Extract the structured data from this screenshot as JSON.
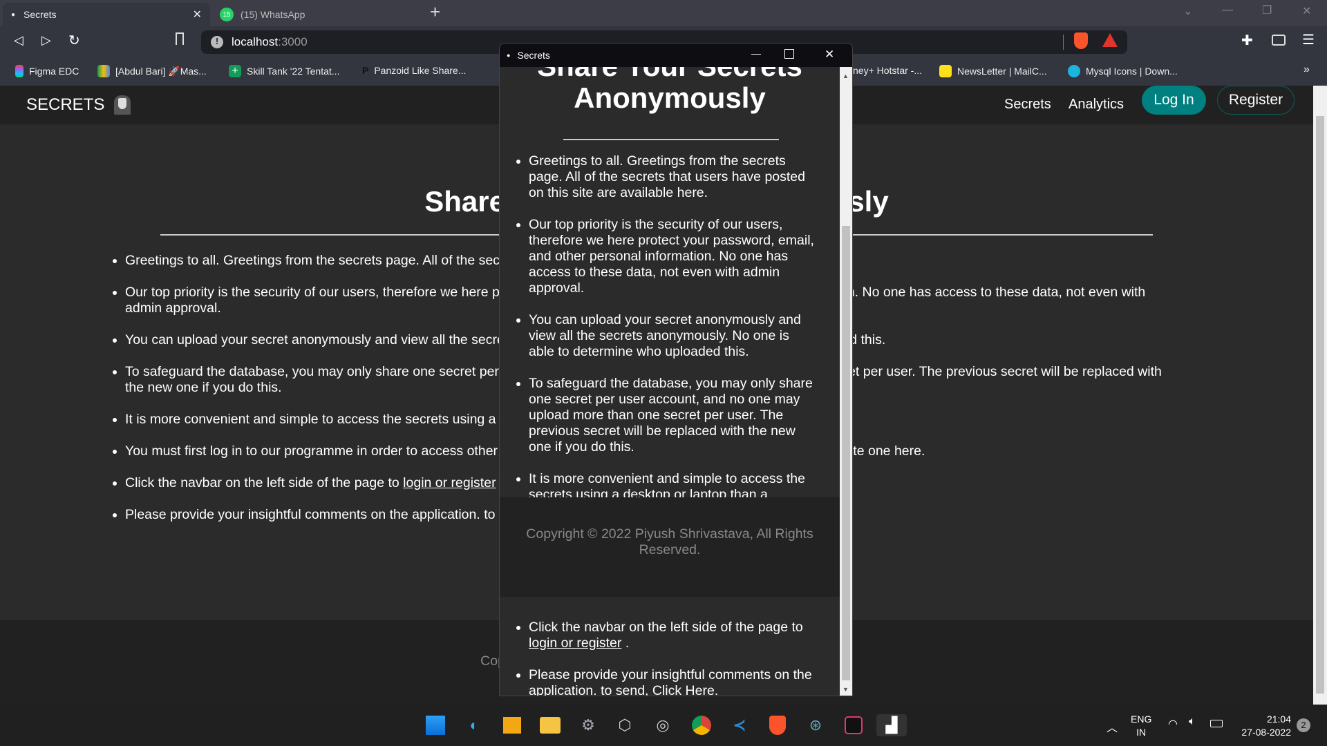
{
  "browser": {
    "tabs": [
      {
        "label": "Secrets",
        "active": true
      },
      {
        "label": "(15) WhatsApp",
        "badge": "15"
      }
    ],
    "new_tab": "+",
    "url_host": "localhost",
    "url_port": ":3000",
    "bookmarks": [
      {
        "label": "Figma EDC",
        "icon": "figma-icon"
      },
      {
        "label": "[Abdul Bari] 🚀Mas...",
        "icon": "google-drive-icon"
      },
      {
        "label": "Skill Tank '22 Tentat...",
        "icon": "google-sheets-icon"
      },
      {
        "label": "Panzoid Like Share...",
        "icon": "panzoid-icon"
      },
      {
        "label": "ney+ Hotstar -...",
        "icon": "hotstar-icon"
      },
      {
        "label": "NewsLetter | MailC...",
        "icon": "mailchimp-icon"
      },
      {
        "label": "Mysql Icons | Down...",
        "icon": "search-icon"
      }
    ],
    "more_bookmarks": "»"
  },
  "site": {
    "brand": "SECRETS",
    "nav": {
      "secrets": "Secrets",
      "analytics": "Analytics",
      "login": "Log In",
      "register": "Register"
    },
    "accent": "#008080",
    "heading": "Share Your Secrets Anonymously",
    "bullets": [
      "Greetings to all. Greetings from the secrets page. All of the secrets that users have posted on this site are available here.",
      "Our top priority is the security of our users, therefore we here protect your password, email, and other personal information. No one has access to these data, not even with admin approval.",
      "You can upload your secret anonymously and view all the secrets anonymously. No one is able to determine who uploaded this.",
      "To safeguard the database, you may only share one secret per user account, and no one may upload more than one secret per user. The previous secret will be replaced with the new one if you do this.",
      "It is more convenient and simple to access the secrets using a desktop or laptop than a",
      "You must first log in to our programme in order to access other secrets. If you don't already have an account, you can create one here."
    ],
    "bullet7_prefix": "Click the navbar on the left side of the page to ",
    "bullet7_link": "login or register",
    "bullet7_suffix": " .",
    "bullet8_prefix": "Please provide your insightful comments on the application. to send, ",
    "bullet8_link": "Click Here",
    "bullet8_suffix": ".",
    "copyright": "Copyright © 2022 Piyush Shrivastava, All Rights Reserved."
  },
  "popup": {
    "title": "Secrets"
  },
  "taskbar": {
    "lang1": "ENG",
    "lang2": "IN",
    "time": "21:04",
    "date": "27-08-2022",
    "notifications": "2"
  }
}
